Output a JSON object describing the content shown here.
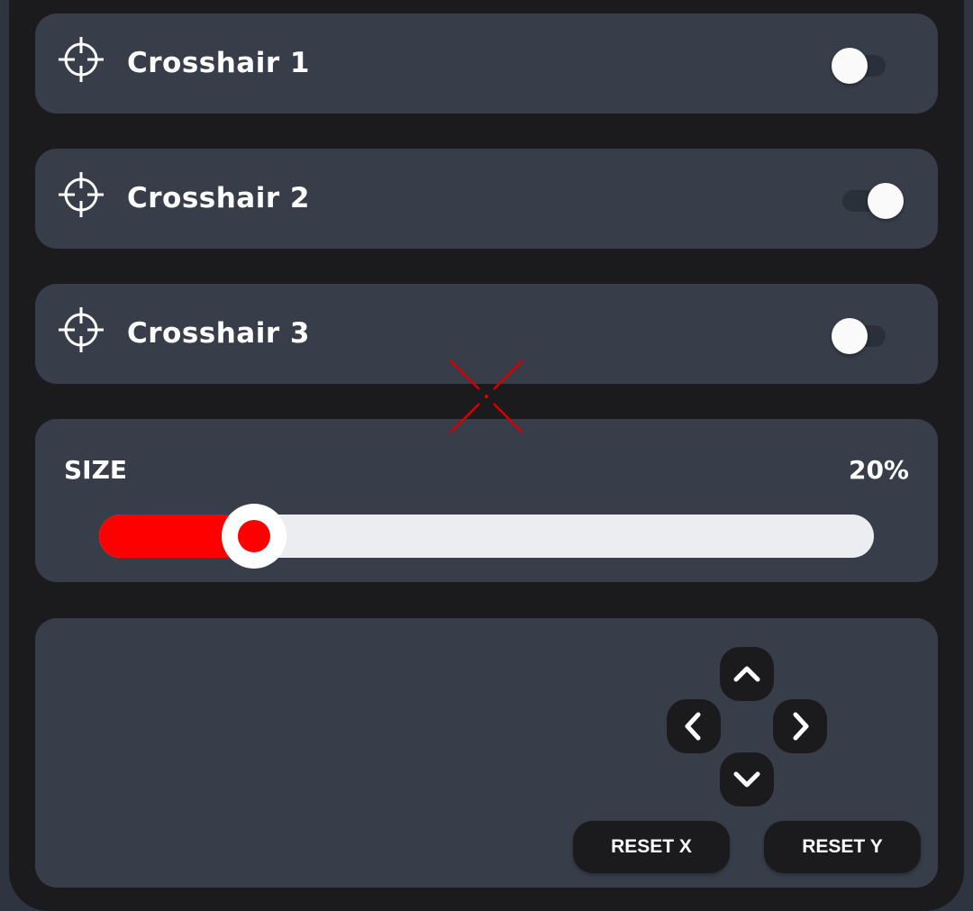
{
  "crosshairs": [
    {
      "label": "Crosshair 1",
      "enabled": false,
      "icon": "crosshair-target-icon"
    },
    {
      "label": "Crosshair 2",
      "enabled": true,
      "icon": "crosshair-target-icon"
    },
    {
      "label": "Crosshair 3",
      "enabled": false,
      "icon": "crosshair-target-icon"
    }
  ],
  "size": {
    "label": "SIZE",
    "value_text": "20%",
    "value": 0.2
  },
  "position_controls": {
    "up_icon": "chevron-up-icon",
    "left_icon": "chevron-left-icon",
    "right_icon": "chevron-right-icon",
    "down_icon": "chevron-down-icon",
    "reset_x_label": "RESET X",
    "reset_y_label": "RESET Y"
  },
  "preview": {
    "icon": "crosshair-preview-icon",
    "color": "#e00000"
  },
  "colors": {
    "accent": "#ff0000",
    "card": "#373e4a",
    "background": "#1b1b1d",
    "text": "#ffffff"
  }
}
